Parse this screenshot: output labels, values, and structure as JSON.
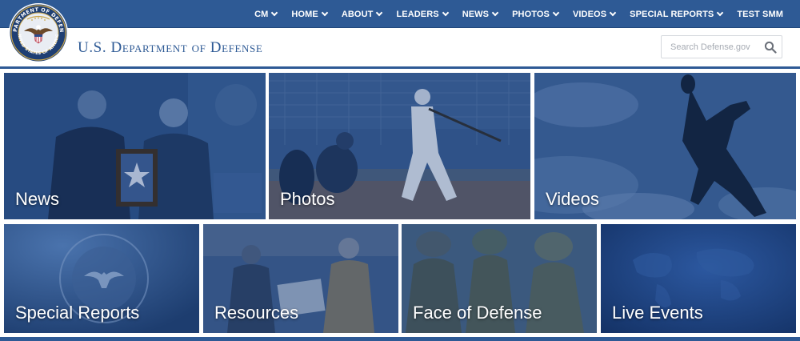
{
  "site": {
    "title": "U.S. Department of Defense",
    "seal_text": "DEPARTMENT OF DEFENSE · UNITED STATES OF AMERICA",
    "brand_color": "#2e5a95"
  },
  "nav": {
    "items": [
      {
        "label": "CM",
        "has_dropdown": true
      },
      {
        "label": "HOME",
        "has_dropdown": true
      },
      {
        "label": "ABOUT",
        "has_dropdown": true
      },
      {
        "label": "LEADERS",
        "has_dropdown": true
      },
      {
        "label": "NEWS",
        "has_dropdown": true
      },
      {
        "label": "PHOTOS",
        "has_dropdown": true
      },
      {
        "label": "VIDEOS",
        "has_dropdown": true
      },
      {
        "label": "SPECIAL REPORTS",
        "has_dropdown": true
      },
      {
        "label": "TEST SMM",
        "has_dropdown": false
      }
    ]
  },
  "search": {
    "placeholder": "Search Defense.gov",
    "icon": "search-icon"
  },
  "tiles": {
    "news": {
      "label": "News"
    },
    "photos": {
      "label": "Photos"
    },
    "videos": {
      "label": "Videos"
    },
    "special_reports": {
      "label": "Special Reports"
    },
    "resources": {
      "label": "Resources"
    },
    "face_of_defense": {
      "label": "Face of Defense"
    },
    "live_events": {
      "label": "Live Events"
    }
  }
}
